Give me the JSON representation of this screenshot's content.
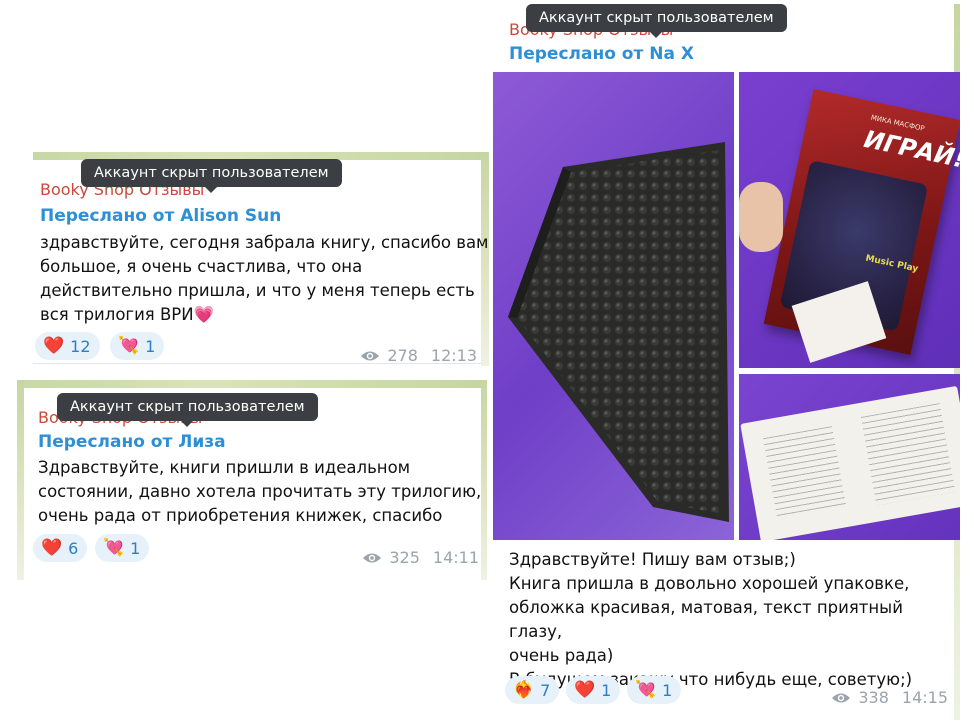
{
  "tooltip_text": "Аккаунт скрыт пользователем",
  "sender_name": "Booky Shop Отзывы",
  "posts": [
    {
      "forwarded_from": "Переслано от Alison Sun",
      "lines": [
        "здравствуйте, сегодня забрала книгу, спасибо вам",
        "большое, я очень счастлива, что она",
        "действительно пришла, и что у меня теперь есть",
        "вся трилогия ВРИ"
      ],
      "trailing_emoji": "💗",
      "reactions": [
        {
          "icon": "heart-icon",
          "glyph": "❤️",
          "count": "12"
        },
        {
          "icon": "heart-arrow-icon",
          "glyph": "💘",
          "count": "1"
        }
      ],
      "views": "278",
      "time": "12:13"
    },
    {
      "forwarded_from": "Переслано от Лиза",
      "lines": [
        "Здравствуйте, книги пришли в идеальном",
        "состоянии, давно хотела прочитать эту трилогию,",
        "очень рада от приобретения книжек, спасибо"
      ],
      "trailing_emoji": "",
      "reactions": [
        {
          "icon": "heart-icon",
          "glyph": "❤️",
          "count": "6"
        },
        {
          "icon": "heart-arrow-icon",
          "glyph": "💘",
          "count": "1"
        }
      ],
      "views": "325",
      "time": "14:11"
    },
    {
      "forwarded_from": "Переслано от Na X",
      "lines": [
        "Здравствуйте! Пишу вам отзыв;)",
        "Книга пришла в довольно хорошей упаковке,",
        "обложка красивая, матовая, текст приятный глазу,",
        "очень рада)",
        "В будущем закажу что нибудь еще, советую;)"
      ],
      "trailing_emoji": "",
      "reactions": [
        {
          "icon": "heart-on-fire-icon",
          "glyph": "❤️‍🔥",
          "count": "7"
        },
        {
          "icon": "heart-icon",
          "glyph": "❤️",
          "count": "1"
        },
        {
          "icon": "heart-arrow-icon",
          "glyph": "💘",
          "count": "1"
        }
      ],
      "views": "338",
      "time": "14:15",
      "book": {
        "author": "МИКА МАСФОР",
        "title": "ИГРАЙ!",
        "badge": "Music Play"
      }
    }
  ]
}
